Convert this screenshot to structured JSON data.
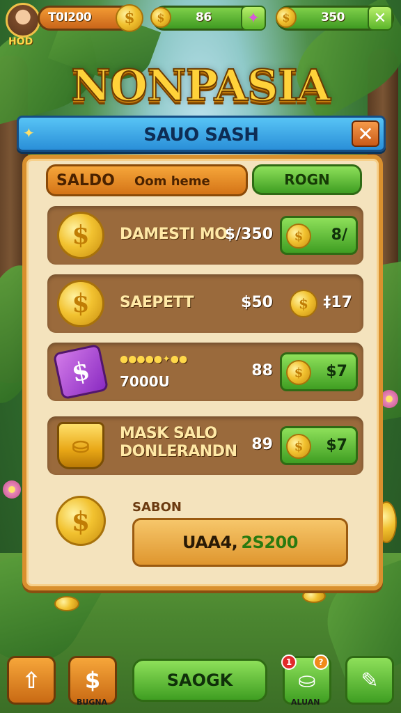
{
  "hud": {
    "player_tag": "HOD",
    "gold_value": "T0I200",
    "gems_value": "86",
    "energy_value": "350"
  },
  "title": "NONPASIA",
  "shop": {
    "header": "SAUO SASH",
    "close_symbol": "✕",
    "tab_primary": "SALDO",
    "tab_primary_sub": "Oom heme",
    "tab_secondary": "ROGN",
    "items": [
      {
        "icon": "coin-icon",
        "name": "DAMESTI MO",
        "price": "$/350",
        "buy_label": "8/"
      },
      {
        "icon": "coin-icon",
        "name": "SAEPETT",
        "price": "$50",
        "buy_label": "‡17"
      },
      {
        "icon": "gem-icon",
        "name": "7000U",
        "price": "88",
        "buy_label": "$7"
      },
      {
        "icon": "bucket-icon",
        "name_line1": "MASK SALO",
        "name_line2": "DONLERANDN",
        "price": "89",
        "buy_label": "$7"
      }
    ],
    "balance_label": "SABON",
    "balance_prefix": "UAA4,",
    "balance_value": "2S200"
  },
  "bottom": {
    "main_button": "SAOGK",
    "left_caption": "BUGNA",
    "right_caption": "ALUAN",
    "badge_red": "1",
    "badge_orange": "?"
  },
  "colors": {
    "accent_gold": "#f2c230",
    "button_green": "#3f9e22",
    "header_blue": "#2a8fd8",
    "panel_bg": "#f4e3bd"
  }
}
